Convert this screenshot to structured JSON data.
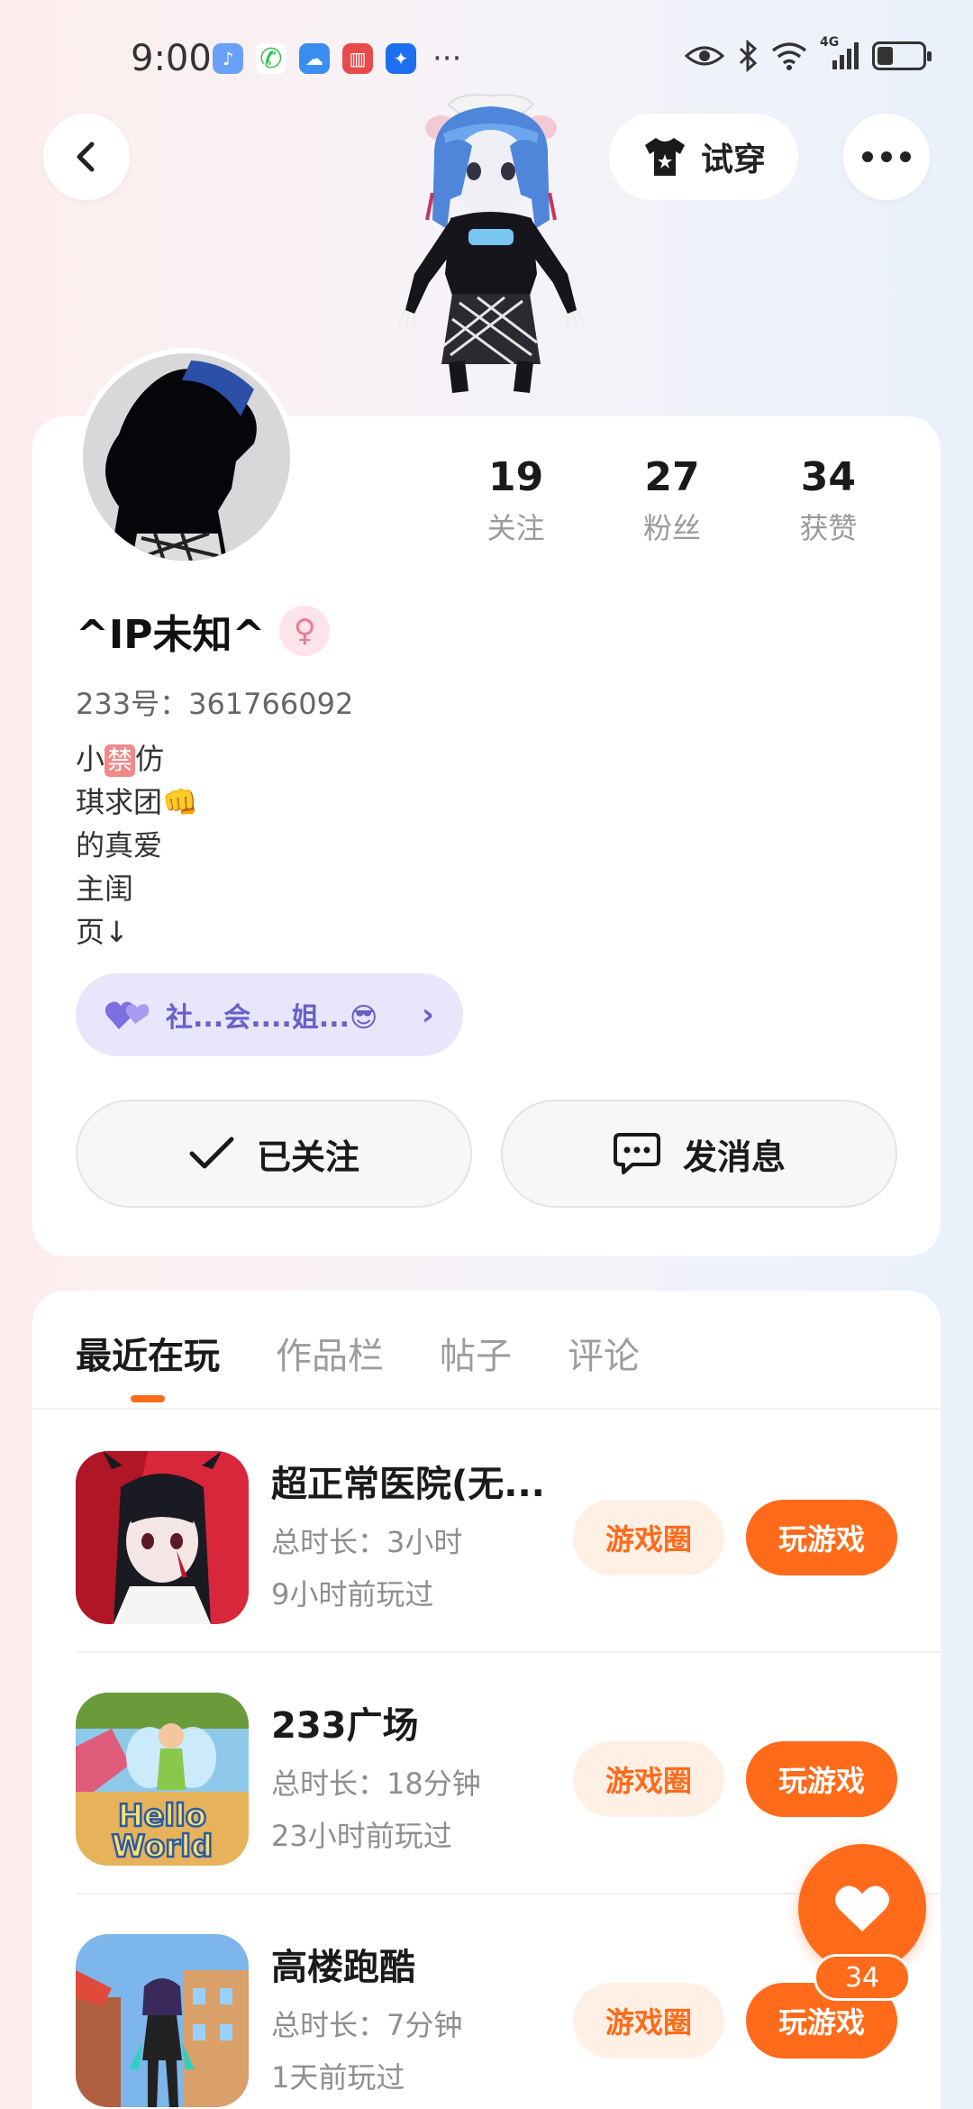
{
  "status_bar": {
    "time": "9:00",
    "more": "···",
    "network": "4G",
    "battery_level": 0.35
  },
  "header": {
    "try_on_label": "试穿"
  },
  "profile": {
    "stats": [
      {
        "value": "19",
        "label": "关注"
      },
      {
        "value": "27",
        "label": "粉丝"
      },
      {
        "value": "34",
        "label": "获赞"
      }
    ],
    "username": "^IP未知^",
    "gender_icon": "♀",
    "uid": "233号：361766092",
    "bio": {
      "line1_a": "小",
      "line1_censor": "禁",
      "line1_b": "仿",
      "line2": "琪求团👊",
      "line3": "的真爱",
      "line4": "主闺",
      "line5": "页↓"
    },
    "club_label": "社...会....姐...😎",
    "follow_label": "已关注",
    "message_label": "发消息"
  },
  "tabs": [
    {
      "label": "最近在玩"
    },
    {
      "label": "作品栏"
    },
    {
      "label": "帖子"
    },
    {
      "label": "评论"
    }
  ],
  "games": [
    {
      "title": "超正常医院(无...",
      "duration": "总时长：3小时",
      "last_played": "9小时前玩过",
      "circle_label": "游戏圈",
      "play_label": "玩游戏"
    },
    {
      "title": "233广场",
      "duration": "总时长：18分钟",
      "last_played": "23小时前玩过",
      "circle_label": "游戏圈",
      "play_label": "玩游戏",
      "thumb_text_1": "Hello",
      "thumb_text_2": "World"
    },
    {
      "title": "高楼跑酷",
      "duration": "总时长：7分钟",
      "last_played": "1天前玩过",
      "circle_label": "游戏圈",
      "play_label": "玩游戏"
    }
  ],
  "like_fab": {
    "count": "34"
  },
  "colors": {
    "accent": "#ff6b1a",
    "accent_light": "#fff0e6",
    "club_bg": "#e8e6fb",
    "club_text": "#6b5fc7"
  }
}
